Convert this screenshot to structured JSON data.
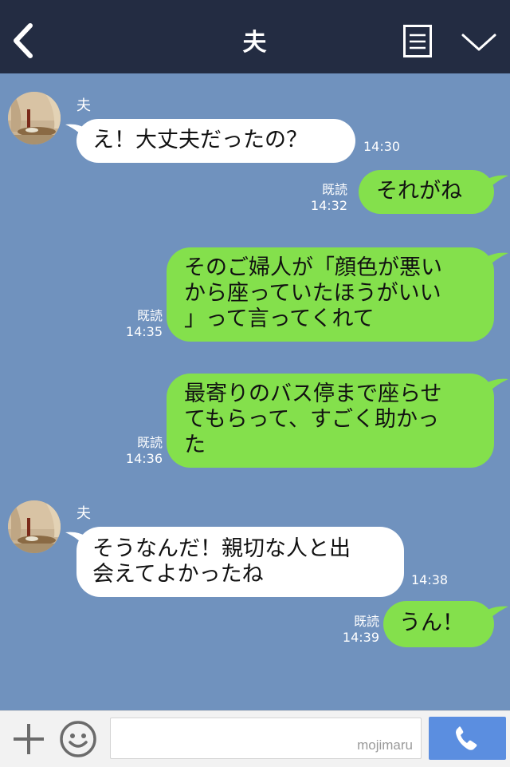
{
  "header": {
    "title": "夫",
    "back_icon": "chevron-left-icon",
    "menu_icon": "list-icon",
    "fold_icon": "chevron-down-icon",
    "background": "#232c42"
  },
  "chat": {
    "background": "#7092be",
    "messages": [
      {
        "direction": "in",
        "sender": "夫",
        "text": "え！大丈夫だったの？",
        "time": "14:30"
      },
      {
        "direction": "out",
        "read": "既読",
        "text": "それがね",
        "time": "14:32"
      },
      {
        "direction": "out",
        "read": "既読",
        "text": "そのご婦人が「顔色が悪い\nから座っていたほうがいい\n」って言ってくれて",
        "time": "14:35"
      },
      {
        "direction": "out",
        "read": "既読",
        "text": "最寄りのバス停まで座らせ\nてもらって、すごく助かっ\nた",
        "time": "14:36"
      },
      {
        "direction": "in",
        "sender": "夫",
        "text": "そうなんだ！親切な人と出\n会えてよかったね",
        "time": "14:38"
      },
      {
        "direction": "out",
        "read": "既読",
        "text": "うん！",
        "time": "14:39"
      }
    ]
  },
  "input_bar": {
    "input_value": "",
    "watermark": "mojimaru",
    "plus_icon": "plus-icon",
    "emoji_icon": "smiley-icon",
    "call_icon": "phone-icon",
    "call_color": "#5b8ee0"
  },
  "colors": {
    "incoming_bubble": "#ffffff",
    "outgoing_bubble": "#84e04c"
  }
}
